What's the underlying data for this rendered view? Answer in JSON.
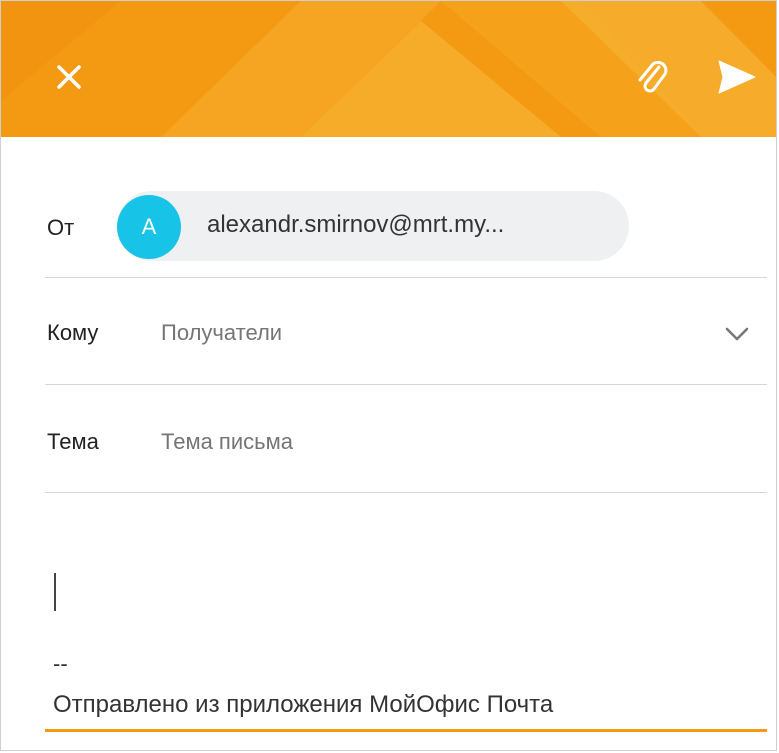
{
  "header": {
    "close_icon": "close-icon",
    "attach_icon": "paperclip-icon",
    "send_icon": "send-icon",
    "accent_color": "#f39a12"
  },
  "from": {
    "label": "От",
    "avatar_letter": "A",
    "avatar_color": "#18c3e8",
    "email": "alexandr.smirnov@mrt.my..."
  },
  "to": {
    "label": "Кому",
    "placeholder": "Получатели",
    "expand_icon": "chevron-down-icon"
  },
  "subject": {
    "label": "Тема",
    "placeholder": "Тема письма"
  },
  "body": {
    "signature_separator": "--",
    "signature": "Отправлено из приложения МойОфис  Почта"
  }
}
